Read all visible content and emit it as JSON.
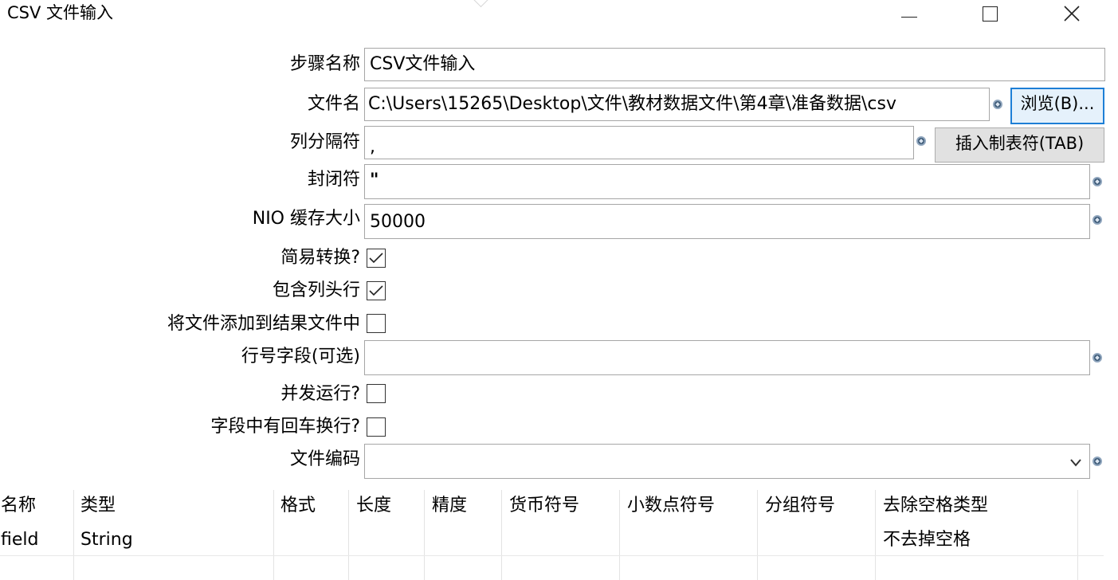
{
  "window": {
    "title": "CSV 文件输入"
  },
  "form": {
    "step_name": {
      "label": "步骤名称",
      "value": "CSV文件输入"
    },
    "filename": {
      "label": "文件名",
      "value": "C:\\Users\\15265\\Desktop\\文件\\教材数据文件\\第4章\\准备数据\\csv",
      "browse_label": "浏览(B)..."
    },
    "delimiter": {
      "label": "列分隔符",
      "value": ",",
      "insert_tab_label": "插入制表符(TAB)"
    },
    "enclosure": {
      "label": "封闭符",
      "value": "\""
    },
    "nio_buffer": {
      "label": "NIO 缓存大小",
      "value": "50000"
    },
    "lazy_conversion": {
      "label": "简易转换?",
      "checked": true
    },
    "header_row": {
      "label": "包含列头行",
      "checked": true
    },
    "add_to_result": {
      "label": "将文件添加到结果文件中",
      "checked": false
    },
    "row_num_field": {
      "label": "行号字段(可选)",
      "value": ""
    },
    "parallel": {
      "label": "并发运行?",
      "checked": false
    },
    "newline_in_field": {
      "label": "字段中有回车换行?",
      "checked": false
    },
    "encoding": {
      "label": "文件编码",
      "value": ""
    }
  },
  "table": {
    "headers": [
      "名称",
      "类型",
      "格式",
      "长度",
      "精度",
      "货币符号",
      "小数点符号",
      "分组符号",
      "去除空格类型"
    ],
    "rows": [
      [
        "field",
        "String",
        "",
        "",
        "",
        "",
        "",
        "",
        "不去掉空格"
      ]
    ]
  }
}
